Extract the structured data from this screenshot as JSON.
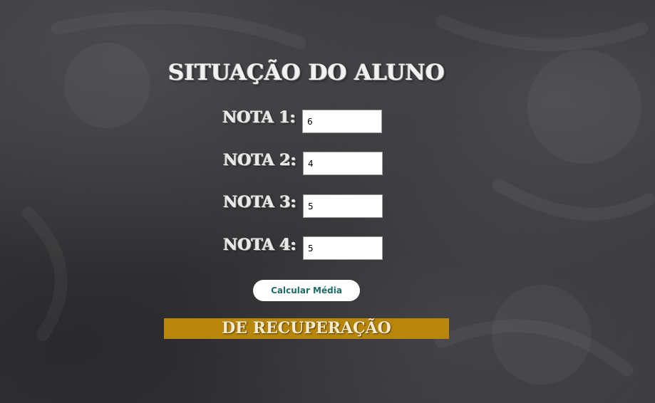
{
  "page": {
    "title": "SITUAÇÃO DO ALUNO"
  },
  "grades": [
    {
      "label": "NOTA 1:",
      "value": "6"
    },
    {
      "label": "NOTA 2:",
      "value": "4"
    },
    {
      "label": "NOTA 3:",
      "value": "5"
    },
    {
      "label": "NOTA 4:",
      "value": "5"
    }
  ],
  "actions": {
    "calculate_label": "Calcular Média"
  },
  "result": {
    "text": "DE RECUPERAÇÃO",
    "color": "#b8860b"
  },
  "theme": {
    "background": "#3a3a3d",
    "button_text": "#1d6b66"
  }
}
